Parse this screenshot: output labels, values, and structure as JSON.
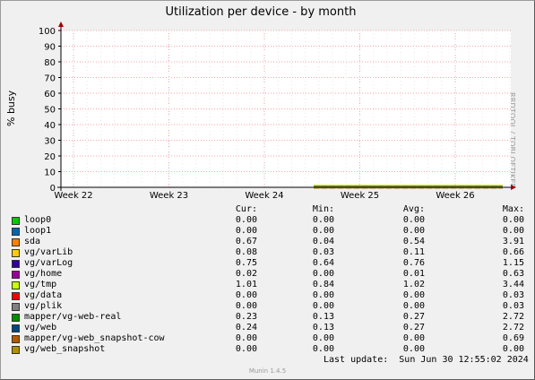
{
  "chart_data": {
    "type": "line",
    "title": "Utilization per device - by month",
    "ylabel": "% busy",
    "watermark": "RRDTOOL / TOBI OETIKER",
    "x_ticks": [
      "Week 22",
      "Week 23",
      "Week 24",
      "Week 25",
      "Week 26"
    ],
    "y_ticks": [
      "0",
      "10",
      "20",
      "30",
      "40",
      "50",
      "60",
      "70",
      "80",
      "90",
      "100"
    ],
    "ylim": [
      0,
      100
    ],
    "grid": true,
    "legend_headers": {
      "cur": "Cur:",
      "min": "Min:",
      "avg": "Avg:",
      "max": "Max:"
    },
    "series": [
      {
        "name": "loop0",
        "color": "#00cc00",
        "cur": "0.00",
        "min": "0.00",
        "avg": "0.00",
        "max": "0.00"
      },
      {
        "name": "loop1",
        "color": "#0066b3",
        "cur": "0.00",
        "min": "0.00",
        "avg": "0.00",
        "max": "0.00"
      },
      {
        "name": "sda",
        "color": "#ff8000",
        "cur": "0.67",
        "min": "0.04",
        "avg": "0.54",
        "max": "3.91"
      },
      {
        "name": "vg/varLib",
        "color": "#ffcc00",
        "cur": "0.08",
        "min": "0.03",
        "avg": "0.11",
        "max": "0.66"
      },
      {
        "name": "vg/varLog",
        "color": "#330099",
        "cur": "0.75",
        "min": "0.64",
        "avg": "0.76",
        "max": "1.15"
      },
      {
        "name": "vg/home",
        "color": "#990099",
        "cur": "0.02",
        "min": "0.00",
        "avg": "0.01",
        "max": "0.63"
      },
      {
        "name": "vg/tmp",
        "color": "#ccff00",
        "cur": "1.01",
        "min": "0.84",
        "avg": "1.02",
        "max": "3.44"
      },
      {
        "name": "vg/data",
        "color": "#ff0000",
        "cur": "0.00",
        "min": "0.00",
        "avg": "0.00",
        "max": "0.03"
      },
      {
        "name": "vg/plik",
        "color": "#808080",
        "cur": "0.00",
        "min": "0.00",
        "avg": "0.00",
        "max": "0.03"
      },
      {
        "name": "mapper/vg-web-real",
        "color": "#008f00",
        "cur": "0.23",
        "min": "0.13",
        "avg": "0.27",
        "max": "2.72"
      },
      {
        "name": "vg/web",
        "color": "#00487d",
        "cur": "0.24",
        "min": "0.13",
        "avg": "0.27",
        "max": "2.72"
      },
      {
        "name": "mapper/vg-web_snapshot-cow",
        "color": "#b35a00",
        "cur": "0.00",
        "min": "0.00",
        "avg": "0.00",
        "max": "0.69"
      },
      {
        "name": "vg/web_snapshot",
        "color": "#b38f00",
        "cur": "0.00",
        "min": "0.00",
        "avg": "0.00",
        "max": "0.00"
      }
    ],
    "last_update": "Last update:  Sun Jun 30 12:55:02 2024",
    "footer": "Munin 1.4.5"
  }
}
